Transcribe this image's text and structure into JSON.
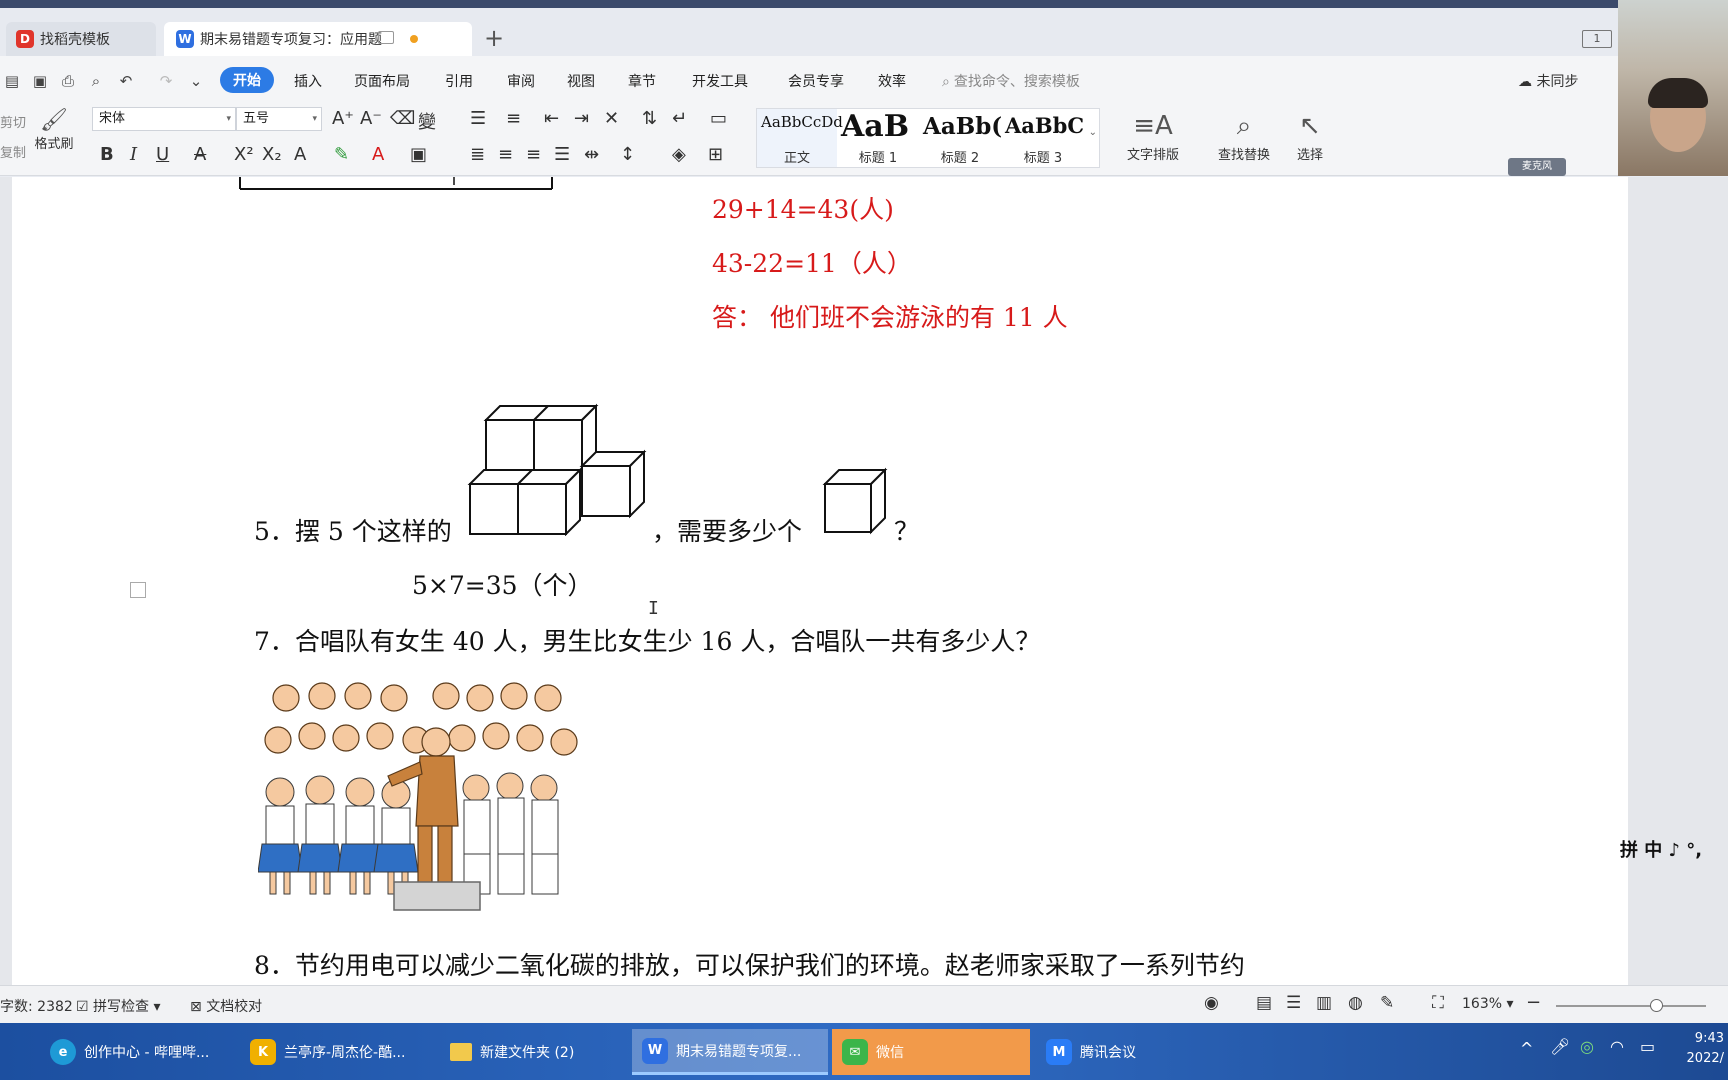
{
  "tabs": [
    {
      "label": "找稻壳模板",
      "icon": "wps-docer-icon"
    },
    {
      "label": "期末易错题专项复习：应用题",
      "icon": "wps-writer-icon"
    }
  ],
  "window_badge": "1",
  "menu": {
    "items": [
      "开始",
      "插入",
      "页面布局",
      "引用",
      "审阅",
      "视图",
      "章节",
      "开发工具",
      "会员专享",
      "效率"
    ],
    "active": "开始",
    "search_placeholder": "查找命令、搜索模板",
    "sync_label": "未同步"
  },
  "ribbon": {
    "cut": "剪切",
    "copy": "复制",
    "format_painter": "格式刷",
    "font_name": "宋体",
    "font_size": "五号",
    "styles": [
      {
        "sample": "AaBbCcDd",
        "name": "正文"
      },
      {
        "sample": "AaB",
        "name": "标题 1"
      },
      {
        "sample": "AaBb(",
        "name": "标题 2"
      },
      {
        "sample": "AaBbC",
        "name": "标题 3"
      }
    ],
    "text_layout": "文字排版",
    "find_replace": "查找替换",
    "select": "选择",
    "mic_label": "麦克风"
  },
  "document": {
    "answer_lines": [
      "29+14=43(人)",
      "43-22=11（人）",
      "答：   他们班不会游泳的有 11 人"
    ],
    "q5_prefix": "5．摆 5 个这样的",
    "q5_middle": "，需要多少个",
    "q5_suffix": "？",
    "q5_answer": "5×7=35（个）",
    "q7": "7．合唱队有女生 40 人，男生比女生少 16 人，合唱队一共有多少人？",
    "q8": "8．节约用电可以减少二氧化碳的排放，可以保护我们的环境。赵老师家采取了一系列节约"
  },
  "status": {
    "word_count": "字数: 2382",
    "spell_check": "拼写检查",
    "doc_proof": "文档校对",
    "zoom": "163%"
  },
  "ime": "拼 中 ♪ °,",
  "taskbar": [
    {
      "label": "创作中心 - 哔哩哔...",
      "icon": "edge-icon",
      "color": "#1e9ad6"
    },
    {
      "label": "兰亭序-周杰伦-酷...",
      "icon": "kugou-icon",
      "color": "#f0b000"
    },
    {
      "label": "新建文件夹 (2)",
      "icon": "folder-icon",
      "color": "#f2c94c"
    },
    {
      "label": "期末易错题专项复...",
      "icon": "wps-writer-icon",
      "color": "#2f6fe0"
    },
    {
      "label": "微信",
      "icon": "wechat-icon",
      "color": "#3bb54a"
    },
    {
      "label": "腾讯会议",
      "icon": "tencent-meeting-icon",
      "color": "#2a7cf6"
    }
  ],
  "clock": {
    "time": "9:43",
    "date": "2022/"
  },
  "colors": {
    "accent": "#2c7be5",
    "answer_red": "#d71a1a"
  }
}
